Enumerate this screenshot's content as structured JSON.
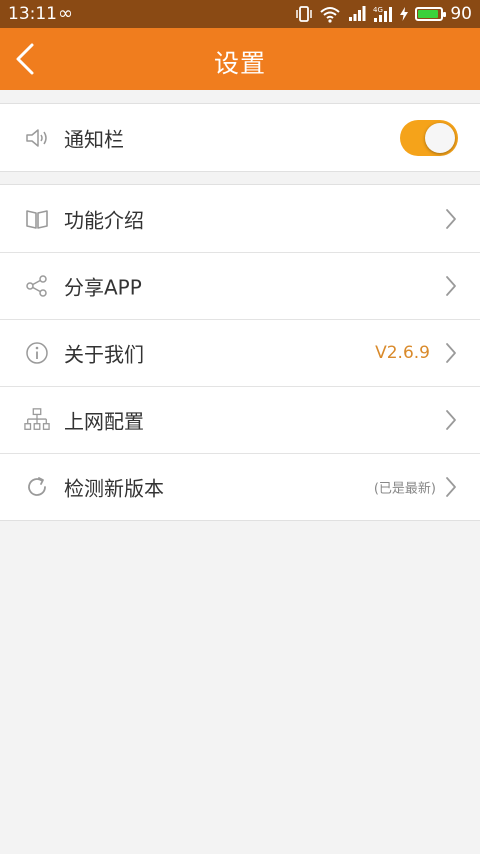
{
  "status_bar": {
    "time": "13:11",
    "battery_pct": "90",
    "battery_level": 0.9
  },
  "header": {
    "title": "设置"
  },
  "notification_row": {
    "label": "通知栏",
    "toggle_on": true
  },
  "menu": {
    "items": [
      {
        "label": "功能介绍",
        "icon": "book-icon"
      },
      {
        "label": "分享APP",
        "icon": "share-icon"
      },
      {
        "label": "关于我们",
        "icon": "info-icon",
        "value": "V2.6.9"
      },
      {
        "label": "上网配置",
        "icon": "network-icon"
      },
      {
        "label": "检测新版本",
        "icon": "refresh-icon",
        "note": "(已是最新)"
      }
    ]
  },
  "colors": {
    "accent": "#f07d1e",
    "toggle_on": "#f5a31a",
    "version_text": "#d98a2b",
    "status_bar": "#8a4a14"
  }
}
